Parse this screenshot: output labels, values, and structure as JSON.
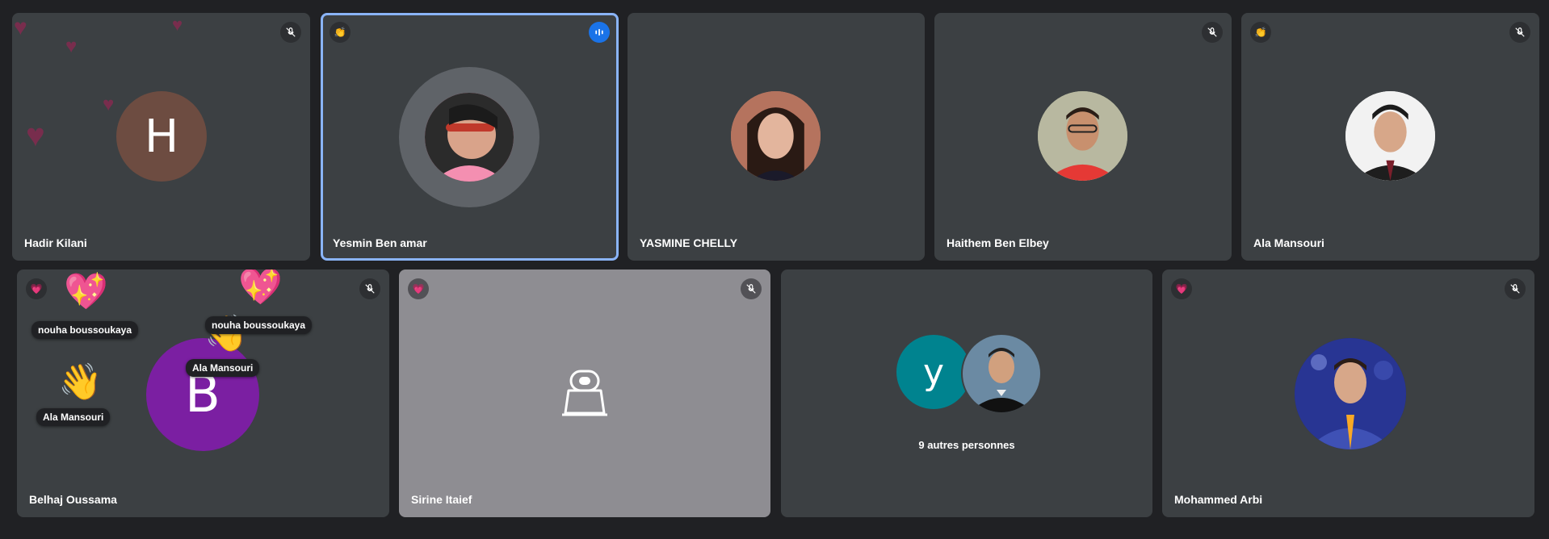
{
  "participants_top": [
    {
      "name": "Hadir Kilani",
      "initial": "H",
      "avatar_color": "#6d4c41",
      "left_icon": "",
      "right_icon": "mic-off-icon"
    },
    {
      "name": "Yesmin Ben amar",
      "left_icon": "👏",
      "right_icon": "speaking-icon",
      "active": true
    },
    {
      "name": "YASMINE CHELLY",
      "left_icon": "",
      "right_icon": ""
    },
    {
      "name": "Haithem Ben Elbey",
      "left_icon": "",
      "right_icon": "mic-off-icon"
    },
    {
      "name": "Ala Mansouri",
      "left_icon": "👏",
      "right_icon": "mic-off-icon"
    }
  ],
  "participants_bottom": [
    {
      "name": "Belhaj Oussama",
      "initial": "B",
      "avatar_color": "#7b1fa2",
      "left_icon": "💗",
      "right_icon": "mic-off-icon"
    },
    {
      "name": "Sirine Itaief",
      "left_icon": "💗",
      "right_icon": "mic-off-icon",
      "camera_off": true
    },
    {
      "others_initial": "y",
      "others_color": "#00838f",
      "others_label": "9 autres personnes"
    },
    {
      "name": "Mohammed Arbi",
      "left_icon": "💗",
      "right_icon": "mic-off-icon"
    }
  ],
  "reactions": [
    {
      "emoji": "💖",
      "sender": "nouha boussoukaya"
    },
    {
      "emoji": "💖",
      "sender": "nouha boussoukaya"
    },
    {
      "emoji": "👋",
      "sender": "Ala Mansouri"
    },
    {
      "emoji": "👋",
      "sender": "Ala Mansouri"
    }
  ],
  "colors": {
    "background": "#202124",
    "tile": "#3c4043",
    "tile_camera_off": "#8e8d92",
    "active_border": "#8ab4f8",
    "speaking": "#1a73e8"
  }
}
